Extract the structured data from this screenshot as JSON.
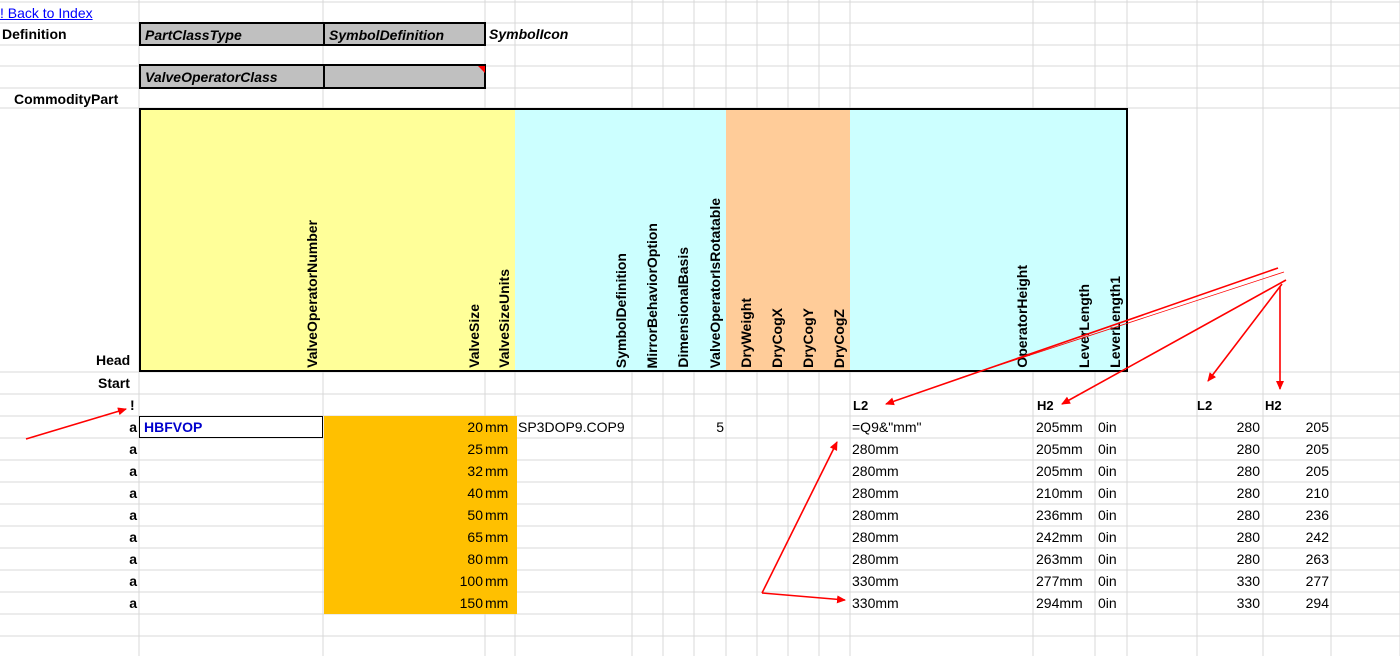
{
  "back_link": "! Back to Index",
  "row_labels": {
    "definition": "Definition",
    "commodity_part": "CommodityPart",
    "head": "Head",
    "start": "Start",
    "bang": "!"
  },
  "definition_headers": [
    "PartClassType",
    "SymbolDefinition",
    "SymbolIcon"
  ],
  "definition_values": [
    "ValveOperatorClass",
    ""
  ],
  "columns": [
    "ValveOperatorNumber",
    "ValveSize",
    "ValveSizeUnits",
    "SymbolDefinition",
    "MirrorBehaviorOption",
    "DimensionalBasis",
    "ValveOperatorIsRotatable",
    "DryWeight",
    "DryCogX",
    "DryCogY",
    "DryCogZ",
    "OperatorHeight",
    "LeverLength",
    "LeverLength1"
  ],
  "bang_row": {
    "l2": "L2",
    "h2": "H2",
    "l2b": "L2",
    "h2b": "H2"
  },
  "rows": [
    {
      "flag": "a",
      "number": "HBFVOP",
      "size": "20",
      "units": "mm",
      "symbol": "SP3DOP9.COP9",
      "rot": "5",
      "height": "=Q9&\"mm\"",
      "lever": "205mm",
      "lever1": "0in",
      "n1": "280",
      "n2": "205"
    },
    {
      "flag": "a",
      "number": "",
      "size": "25",
      "units": "mm",
      "symbol": "",
      "rot": "",
      "height": "280mm",
      "lever": "205mm",
      "lever1": "0in",
      "n1": "280",
      "n2": "205"
    },
    {
      "flag": "a",
      "number": "",
      "size": "32",
      "units": "mm",
      "symbol": "",
      "rot": "",
      "height": "280mm",
      "lever": "205mm",
      "lever1": "0in",
      "n1": "280",
      "n2": "205"
    },
    {
      "flag": "a",
      "number": "",
      "size": "40",
      "units": "mm",
      "symbol": "",
      "rot": "",
      "height": "280mm",
      "lever": "210mm",
      "lever1": "0in",
      "n1": "280",
      "n2": "210"
    },
    {
      "flag": "a",
      "number": "",
      "size": "50",
      "units": "mm",
      "symbol": "",
      "rot": "",
      "height": "280mm",
      "lever": "236mm",
      "lever1": "0in",
      "n1": "280",
      "n2": "236"
    },
    {
      "flag": "a",
      "number": "",
      "size": "65",
      "units": "mm",
      "symbol": "",
      "rot": "",
      "height": "280mm",
      "lever": "242mm",
      "lever1": "0in",
      "n1": "280",
      "n2": "242"
    },
    {
      "flag": "a",
      "number": "",
      "size": "80",
      "units": "mm",
      "symbol": "",
      "rot": "",
      "height": "280mm",
      "lever": "263mm",
      "lever1": "0in",
      "n1": "280",
      "n2": "263"
    },
    {
      "flag": "a",
      "number": "",
      "size": "100",
      "units": "mm",
      "symbol": "",
      "rot": "",
      "height": "330mm",
      "lever": "277mm",
      "lever1": "0in",
      "n1": "330",
      "n2": "277"
    },
    {
      "flag": "a",
      "number": "",
      "size": "150",
      "units": "mm",
      "symbol": "",
      "rot": "",
      "height": "330mm",
      "lever": "294mm",
      "lever1": "0in",
      "n1": "330",
      "n2": "294"
    }
  ],
  "colors": {
    "link": "#0000ff",
    "header_gray": "#c0c0c0",
    "yellow": "#ffff99",
    "cyan": "#ccffff",
    "peach": "#ffcc99",
    "size_fill": "#ffc000",
    "annotation_arrow": "#ff0000",
    "number_text": "#0000cc"
  }
}
